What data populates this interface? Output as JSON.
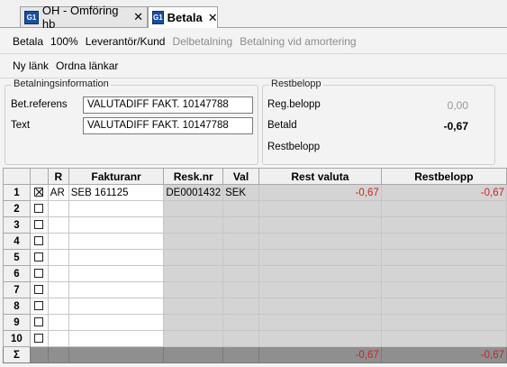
{
  "tabs": [
    {
      "icon": "G1",
      "title": "OH - Omföring hb",
      "close": "✕"
    },
    {
      "icon": "G1",
      "title": "Betala",
      "close": "✕"
    }
  ],
  "toolbar1": [
    "Betala",
    "100%",
    "Leverantör/Kund",
    "Delbetalning",
    "Betalning vid amortering"
  ],
  "toolbar2": [
    "Ny länk",
    "Ordna länkar"
  ],
  "betalningsinfo": {
    "legend": "Betalningsinformation",
    "bet_ref_label": "Bet.referens",
    "bet_ref_value": "VALUTADIFF FAKT. 10147788",
    "text_label": "Text",
    "text_value": "VALUTADIFF FAKT. 10147788"
  },
  "restbelopp_panel": {
    "legend": "Restbelopp",
    "reg_label": "Reg.belopp",
    "reg_value": "0,00",
    "betald_label": "Betald",
    "betald_value": "-0,67",
    "rest_label": "Restbelopp"
  },
  "grid": {
    "headers": [
      "",
      "R",
      "Fakturanr",
      "Resk.nr",
      "Val",
      "Rest valuta",
      "Restbelopp"
    ],
    "rows": [
      {
        "num": "1",
        "checked": true,
        "r": "AR",
        "fakturanr": "SEB 161125",
        "resknr": "DE0001432",
        "val": "SEK",
        "rest_valuta": "-0,67",
        "restbelopp": "-0,67"
      },
      {
        "num": "2",
        "checked": false,
        "r": "",
        "fakturanr": "",
        "resknr": "",
        "val": "",
        "rest_valuta": "",
        "restbelopp": ""
      },
      {
        "num": "3",
        "checked": false,
        "r": "",
        "fakturanr": "",
        "resknr": "",
        "val": "",
        "rest_valuta": "",
        "restbelopp": ""
      },
      {
        "num": "4",
        "checked": false,
        "r": "",
        "fakturanr": "",
        "resknr": "",
        "val": "",
        "rest_valuta": "",
        "restbelopp": ""
      },
      {
        "num": "5",
        "checked": false,
        "r": "",
        "fakturanr": "",
        "resknr": "",
        "val": "",
        "rest_valuta": "",
        "restbelopp": ""
      },
      {
        "num": "6",
        "checked": false,
        "r": "",
        "fakturanr": "",
        "resknr": "",
        "val": "",
        "rest_valuta": "",
        "restbelopp": ""
      },
      {
        "num": "7",
        "checked": false,
        "r": "",
        "fakturanr": "",
        "resknr": "",
        "val": "",
        "rest_valuta": "",
        "restbelopp": ""
      },
      {
        "num": "8",
        "checked": false,
        "r": "",
        "fakturanr": "",
        "resknr": "",
        "val": "",
        "rest_valuta": "",
        "restbelopp": ""
      },
      {
        "num": "9",
        "checked": false,
        "r": "",
        "fakturanr": "",
        "resknr": "",
        "val": "",
        "rest_valuta": "",
        "restbelopp": ""
      },
      {
        "num": "10",
        "checked": false,
        "r": "",
        "fakturanr": "",
        "resknr": "",
        "val": "",
        "rest_valuta": "",
        "restbelopp": ""
      }
    ],
    "sum": {
      "label": "Σ",
      "rest_valuta": "-0,67",
      "restbelopp": "-0,67"
    }
  }
}
